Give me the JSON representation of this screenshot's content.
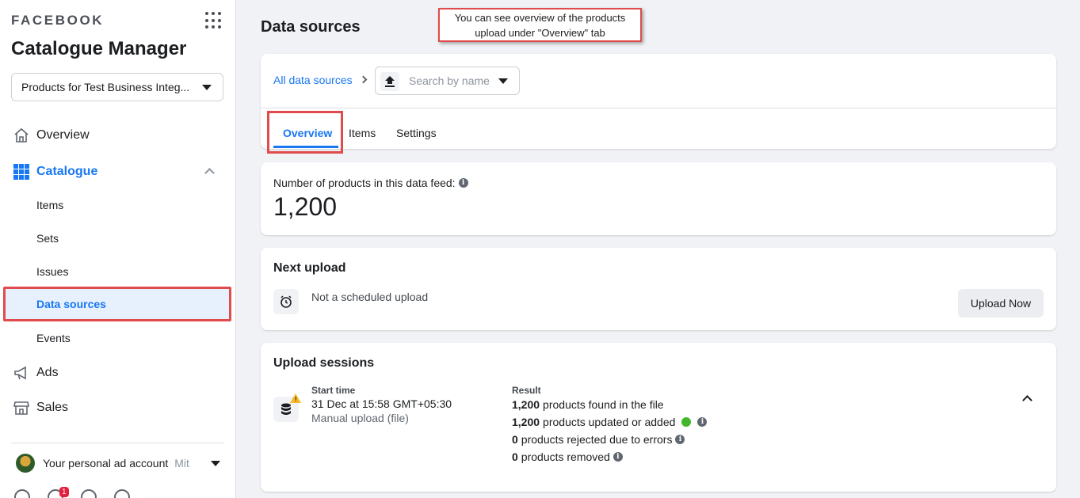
{
  "sidebar": {
    "brand": "FACEBOOK",
    "app_title": "Catalogue Manager",
    "catalog_select": "Products for Test Business Integ...",
    "nav": {
      "overview": "Overview",
      "catalogue": "Catalogue",
      "items": "Items",
      "sets": "Sets",
      "issues": "Issues",
      "data_sources": "Data sources",
      "events": "Events",
      "ads": "Ads",
      "sales": "Sales"
    },
    "account": {
      "name": "Your personal ad account",
      "sub": "Mit"
    },
    "notification_count": "1"
  },
  "main": {
    "title": "Data sources",
    "callout": "You can see overview of the products upload under \"Overview\" tab",
    "breadcrumb": "All data sources",
    "search_placeholder": "Search by name",
    "tabs": [
      "Overview",
      "Items",
      "Settings"
    ],
    "metric": {
      "label": "Number of products in this data feed:",
      "value": "1,200"
    },
    "next_upload": {
      "title": "Next upload",
      "status": "Not a scheduled upload",
      "button": "Upload Now"
    },
    "sessions": {
      "title": "Upload sessions",
      "start_head": "Start time",
      "start_value": "31 Dec at 15:58 GMT+05:30",
      "start_sub": "Manual upload (file)",
      "result_head": "Result",
      "results": [
        {
          "count": "1,200",
          "text": "products found in the file"
        },
        {
          "count": "1,200",
          "text": "products updated or added"
        },
        {
          "count": "0",
          "text": "products rejected due to errors"
        },
        {
          "count": "0",
          "text": "products removed"
        }
      ]
    }
  },
  "colors": {
    "accent": "#1877f2",
    "highlight_border": "#e04b4b",
    "success": "#42b72a",
    "warning": "#f7b928"
  }
}
